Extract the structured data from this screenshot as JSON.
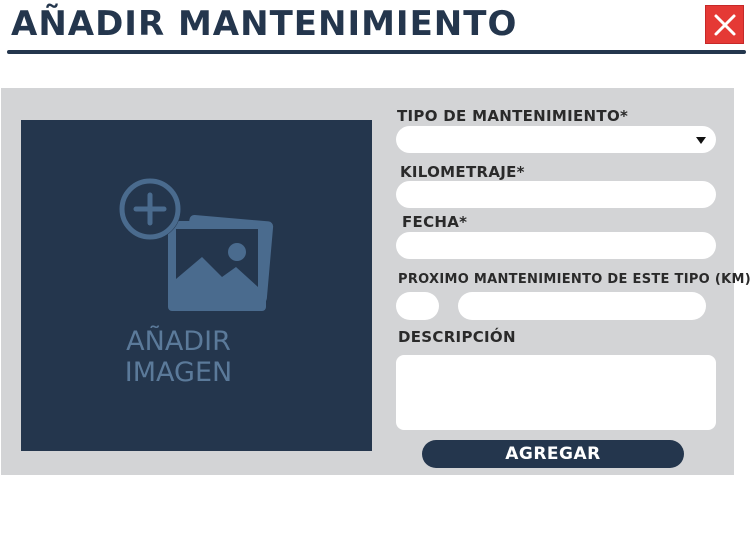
{
  "dialog": {
    "title": "AÑADIR MANTENIMIENTO",
    "close_icon": "close-icon",
    "close_color": "#e53935",
    "accent_color": "#24364d"
  },
  "image_upload": {
    "icon": "add-image-icon",
    "label_line1": "AÑADIR",
    "label_line2": "IMAGEN"
  },
  "form": {
    "tipo_label": "TIPO DE MANTENIMIENTO*",
    "tipo_value": "",
    "kilometraje_label": "KILOMETRAJE*",
    "kilometraje_value": "",
    "fecha_label": "FECHA*",
    "fecha_value": "",
    "proximo_label": "PROXIMO MANTENIMIENTO DE ESTE TIPO (KM)",
    "proximo_value_a": "",
    "proximo_value_b": "",
    "descripcion_label": "DESCRIPCIÓN",
    "descripcion_value": "",
    "submit_label": "AGREGAR"
  }
}
